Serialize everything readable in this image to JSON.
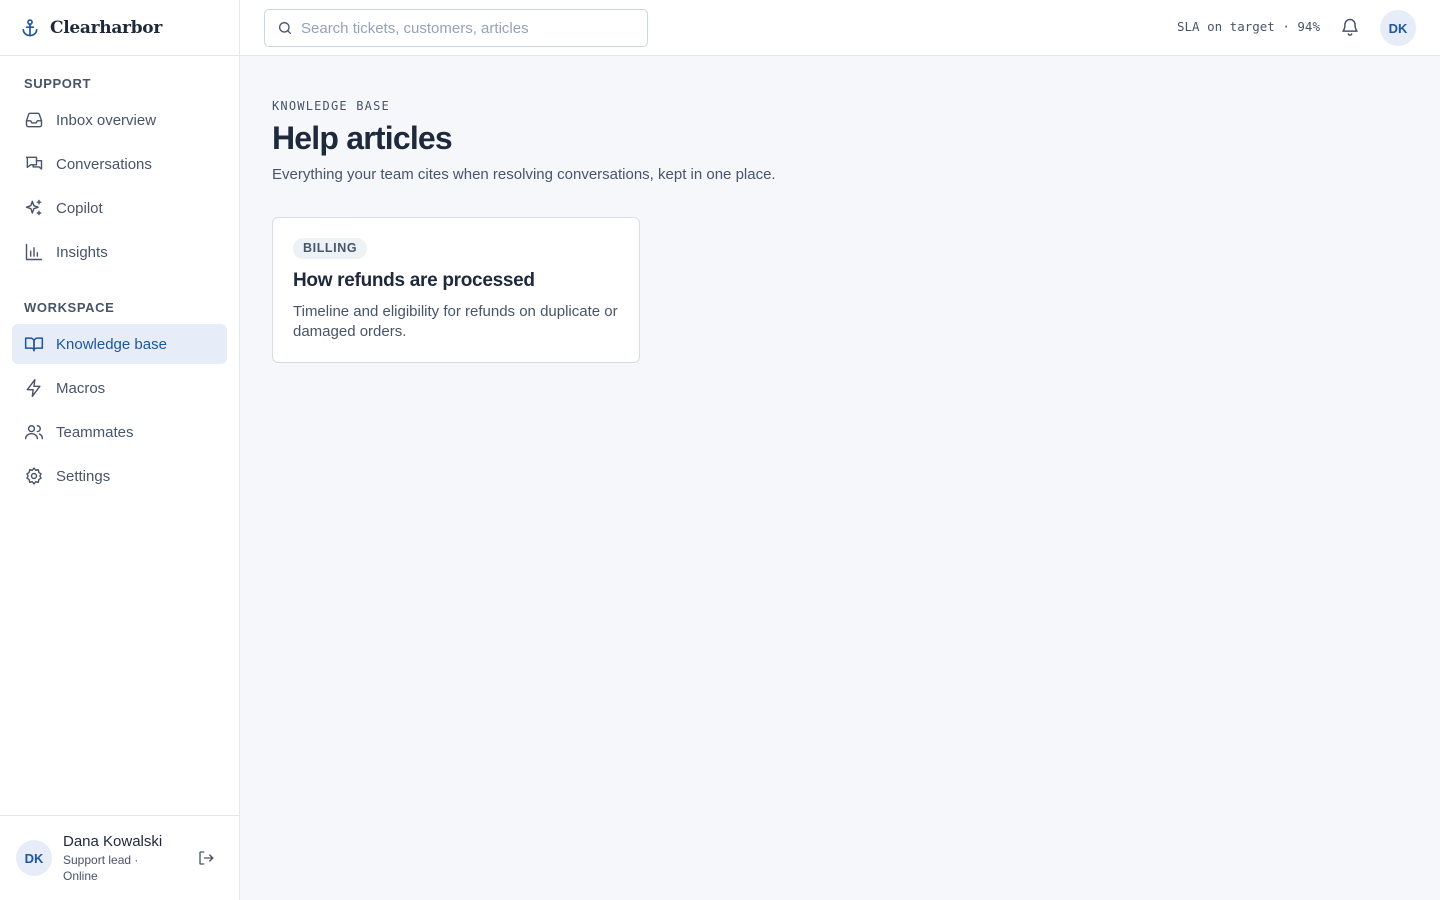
{
  "brand": {
    "name": "Clearharbor",
    "icon": "anchor-icon"
  },
  "sidebar": {
    "sections": [
      {
        "label": "SUPPORT",
        "items": [
          {
            "label": "Inbox overview",
            "icon": "inbox-icon"
          },
          {
            "label": "Conversations",
            "icon": "chat-icon"
          },
          {
            "label": "Copilot",
            "icon": "sparkles-icon"
          },
          {
            "label": "Insights",
            "icon": "bar-chart-icon"
          }
        ]
      },
      {
        "label": "WORKSPACE",
        "items": [
          {
            "label": "Knowledge base",
            "icon": "book-icon",
            "active": true
          },
          {
            "label": "Macros",
            "icon": "bolt-icon"
          },
          {
            "label": "Teammates",
            "icon": "users-icon"
          },
          {
            "label": "Settings",
            "icon": "gear-icon"
          }
        ]
      }
    ],
    "user": {
      "initials": "DK",
      "name": "Dana Kowalski",
      "role_line1": "Support lead ·",
      "role_line2": "Online"
    }
  },
  "topbar": {
    "search_placeholder": "Search tickets, customers, articles",
    "sla_text": "SLA on target · 94%",
    "avatar_initials": "DK"
  },
  "main": {
    "eyebrow": "KNOWLEDGE BASE",
    "title": "Help articles",
    "subtitle": "Everything your team cites when resolving conversations, kept in one place.",
    "articles": [
      {
        "category": "BILLING",
        "title": "How refunds are processed",
        "description": "Timeline and eligibility for refunds on duplicate or damaged orders."
      }
    ]
  },
  "colors": {
    "accent": "#1e56a0",
    "active_bg": "#e6edf8",
    "page_bg": "#f5f7fb",
    "border": "#e2e8f0",
    "text": "#1e293b",
    "muted": "#475569"
  }
}
